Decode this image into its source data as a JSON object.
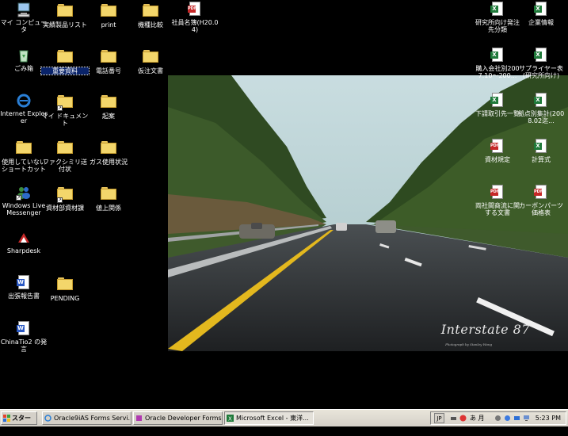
{
  "wallpaper": {
    "caption": "Interstate 87",
    "credit": "Photograph by Stanley Wong"
  },
  "icons_left": [
    {
      "label": "マイ コンピュータ",
      "type": "computer"
    },
    {
      "label": "実績製品リスト",
      "type": "folder"
    },
    {
      "label": "print",
      "type": "folder"
    },
    {
      "label": "機種比較",
      "type": "folder"
    },
    {
      "label": "社員名簿(H20.04)",
      "type": "pdf"
    },
    {
      "label": "ごみ箱",
      "type": "recycle"
    },
    {
      "label": "重要資料",
      "type": "folder"
    },
    {
      "label": "電話番号",
      "type": "folder"
    },
    {
      "label": "仮注文書",
      "type": "folder"
    },
    {
      "label": "Internet Explorer",
      "type": "ie"
    },
    {
      "label": "マイ ドキュメント",
      "type": "mydocs"
    },
    {
      "label": "起案",
      "type": "folder"
    },
    {
      "label": "使用していないショートカット",
      "type": "folder"
    },
    {
      "label": "ファクシミリ送付状",
      "type": "folder"
    },
    {
      "label": "ガス使用状況",
      "type": "folder"
    },
    {
      "label": "Windows Live Messenger",
      "type": "messenger"
    },
    {
      "label": "資材部資材課",
      "type": "folder"
    },
    {
      "label": "値上関係",
      "type": "folder"
    },
    {
      "label": "Sharpdesk",
      "type": "sharpdesk"
    },
    {
      "label": "出張報告書",
      "type": "word"
    },
    {
      "label": "PENDING",
      "type": "folder"
    },
    {
      "label": "ChinaTio2 の発言",
      "type": "word"
    }
  ],
  "icons_right": [
    {
      "label": "研究所向け発注先分類",
      "type": "excel"
    },
    {
      "label": "企業情報",
      "type": "excel"
    },
    {
      "label": "購入会社別2007.10～200...",
      "type": "excel"
    },
    {
      "label": "サプライヤー表(研究所向け)",
      "type": "excel"
    },
    {
      "label": "下請取引先一覧",
      "type": "excel"
    },
    {
      "label": "拠点別集計(2008.02迄...",
      "type": "excel"
    },
    {
      "label": "資材規定",
      "type": "pdf"
    },
    {
      "label": "計算式",
      "type": "excel"
    },
    {
      "label": "両社間商流に関する文書",
      "type": "pdf"
    },
    {
      "label": "カーボンパーツ価格表",
      "type": "pdf"
    }
  ],
  "taskbar": {
    "start_label": "スタート",
    "buttons": [
      {
        "label": "Oracle9iAS Forms Servi...",
        "icon": "ie-icon"
      },
      {
        "label": "Oracle Developer Forms...",
        "icon": "oracle-icon"
      },
      {
        "label": "Microsoft Excel - 東洋...",
        "icon": "excel-icon"
      }
    ],
    "lang": "JP",
    "ime_text": "あ 月",
    "clock": "5:23 PM"
  }
}
